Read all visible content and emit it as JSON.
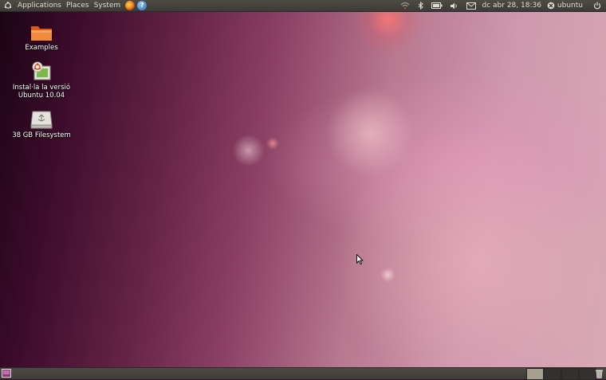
{
  "top_panel": {
    "menus": [
      "Applications",
      "Places",
      "System"
    ],
    "launchers": [
      "firefox-icon",
      "help-icon"
    ],
    "help_glyph": "?",
    "clock": "dc abr 28, 18:36",
    "user": "ubuntu",
    "tray_icons": [
      "network-icon",
      "bluetooth-icon",
      "battery-icon",
      "volume-icon",
      "mail-icon"
    ]
  },
  "desktop": {
    "icons": [
      {
        "label": "Examples",
        "icon": "folder-icon"
      },
      {
        "label": "Instal·la la versió Ubuntu 10.04",
        "icon": "installer-icon"
      },
      {
        "label": "38 GB Filesystem",
        "icon": "drive-icon"
      }
    ]
  },
  "bottom_panel": {
    "workspaces": 4,
    "active_workspace": 1
  },
  "colors": {
    "panel": "#3c3b37",
    "panel_text": "#dfdbd2",
    "wallpaper_dark": "#2a0820",
    "wallpaper_light": "#d9a9b6"
  }
}
